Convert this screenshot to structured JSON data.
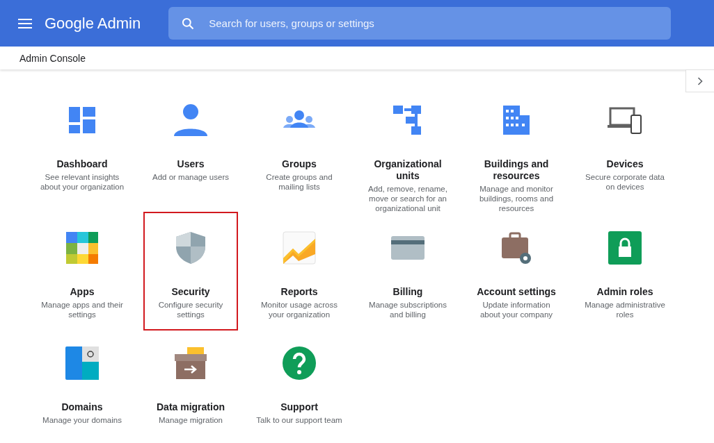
{
  "header": {
    "product": "Google Admin",
    "search": {
      "placeholder": "Search for users, groups or settings"
    }
  },
  "breadcrumb": "Admin Console",
  "tiles": [
    {
      "title": "Dashboard",
      "description": "See relevant insights about your organization",
      "selected": false
    },
    {
      "title": "Users",
      "description": "Add or manage users",
      "selected": false
    },
    {
      "title": "Groups",
      "description": "Create groups and mailing lists",
      "selected": false
    },
    {
      "title": "Organizational units",
      "description": "Add, remove, rename, move or search for an organizational unit",
      "selected": false
    },
    {
      "title": "Buildings and resources",
      "description": "Manage and monitor buildings, rooms and resources",
      "selected": false
    },
    {
      "title": "Devices",
      "description": "Secure corporate data on devices",
      "selected": false
    },
    {
      "title": "Apps",
      "description": "Manage apps and their settings",
      "selected": false
    },
    {
      "title": "Security",
      "description": "Configure security settings",
      "selected": true
    },
    {
      "title": "Reports",
      "description": "Monitor usage across your organization",
      "selected": false
    },
    {
      "title": "Billing",
      "description": "Manage subscriptions and billing",
      "selected": false
    },
    {
      "title": "Account settings",
      "description": "Update information about your company",
      "selected": false
    },
    {
      "title": "Admin roles",
      "description": "Manage administrative roles",
      "selected": false
    },
    {
      "title": "Domains",
      "description": "Manage your domains",
      "selected": false
    },
    {
      "title": "Data migration",
      "description": "Manage migration",
      "selected": false
    },
    {
      "title": "Support",
      "description": "Talk to our support team",
      "selected": false
    }
  ]
}
